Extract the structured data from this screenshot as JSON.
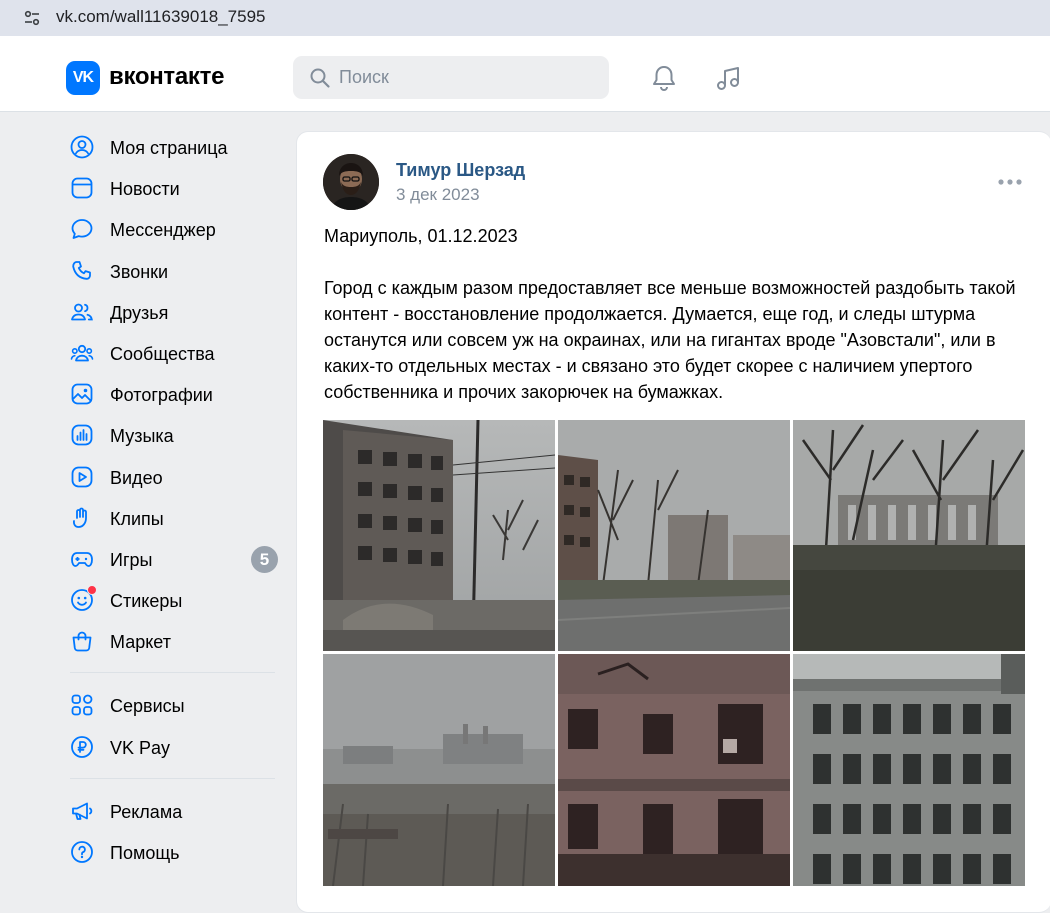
{
  "browser": {
    "url": "vk.com/wall11639018_7595"
  },
  "header": {
    "logo_mark": "VK",
    "logo_text": "вконтакте",
    "search_placeholder": "Поиск"
  },
  "sidebar": {
    "items": [
      {
        "label": "Моя страница",
        "icon": "user-circle-icon"
      },
      {
        "label": "Новости",
        "icon": "news-icon"
      },
      {
        "label": "Мессенджер",
        "icon": "message-icon"
      },
      {
        "label": "Звонки",
        "icon": "phone-icon"
      },
      {
        "label": "Друзья",
        "icon": "friends-icon"
      },
      {
        "label": "Сообщества",
        "icon": "communities-icon"
      },
      {
        "label": "Фотографии",
        "icon": "photo-icon"
      },
      {
        "label": "Музыка",
        "icon": "music-bars-icon"
      },
      {
        "label": "Видео",
        "icon": "video-icon"
      },
      {
        "label": "Клипы",
        "icon": "clips-icon"
      },
      {
        "label": "Игры",
        "icon": "gamepad-icon",
        "badge": "5"
      },
      {
        "label": "Стикеры",
        "icon": "sticker-icon"
      },
      {
        "label": "Маркет",
        "icon": "market-bag-icon"
      }
    ],
    "services": [
      {
        "label": "Сервисы",
        "icon": "services-grid-icon"
      },
      {
        "label": "VK Pay",
        "icon": "vkpay-icon"
      }
    ],
    "footer": [
      {
        "label": "Реклама",
        "icon": "megaphone-icon"
      },
      {
        "label": "Помощь",
        "icon": "help-icon"
      }
    ]
  },
  "post": {
    "author": "Тимур Шерзад",
    "date": "3 дек 2023",
    "text_title": "Мариуполь, 01.12.2023",
    "text_body": "Город с каждым разом предоставляет все меньше возможностей раздобыть такой контент - восстановление продолжается. Думается, еще год, и следы штурма останутся или совсем уж на окраинах, или на гигантах вроде \"Азовстали\", или в каких-то отдельных местах - и связано это будет скорее с наличием упертого собственника и прочих закорючек на бумажках."
  },
  "colors": {
    "accent": "#0077ff",
    "link": "#2a5885",
    "muted": "#818c99",
    "background": "#edeef0"
  }
}
